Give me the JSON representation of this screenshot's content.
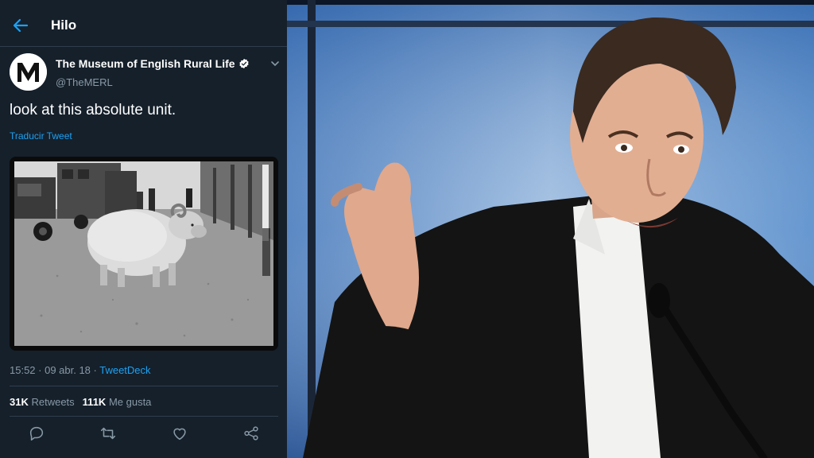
{
  "header": {
    "title": "Hilo"
  },
  "account": {
    "name": "The Museum of English Rural Life",
    "handle": "@TheMERL"
  },
  "tweet": {
    "text": "look at this absolute unit.",
    "translate_label": "Traducir Tweet",
    "time": "15:52 · 09 abr. 18 · ",
    "client": "TweetDeck"
  },
  "stats": {
    "retweets_count": "31K",
    "retweets_label": " Retweets",
    "likes_count": "111K",
    "likes_label": " Me gusta"
  },
  "icons": {
    "back": "arrow-left-icon",
    "verified": "verified-badge-icon",
    "caret": "chevron-down-icon",
    "reply": "reply-icon",
    "retweet": "retweet-icon",
    "like": "heart-icon",
    "share": "share-icon"
  },
  "colors": {
    "background": "#15202b",
    "accent": "#1da1f2",
    "muted": "#8899a6",
    "divider": "#2f3e4d"
  }
}
